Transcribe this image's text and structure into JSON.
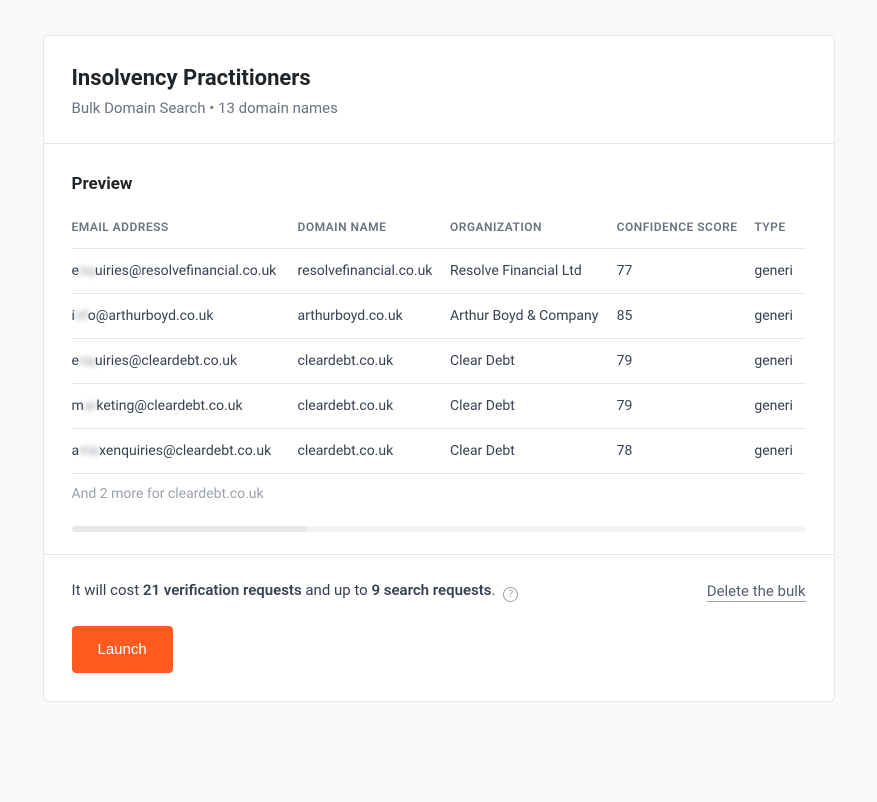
{
  "header": {
    "title": "Insolvency Practitioners",
    "subtitle": "Bulk Domain Search • 13 domain names"
  },
  "preview": {
    "title": "Preview",
    "columns": {
      "email": "EMAIL ADDRESS",
      "domain": "DOMAIN NAME",
      "org": "ORGANIZATION",
      "score": "CONFIDENCE SCORE",
      "type": "TYPE"
    },
    "rows": [
      {
        "prefix": "e",
        "obscured": "nq",
        "rest": "uiries@resolvefinancial.co.uk",
        "domain": "resolvefinancial.co.uk",
        "org": "Resolve Financial Ltd",
        "score": "77",
        "type": "generi"
      },
      {
        "prefix": "i",
        "obscured": "nf",
        "rest": "o@arthurboyd.co.uk",
        "domain": "arthurboyd.co.uk",
        "org": "Arthur Boyd & Company",
        "score": "85",
        "type": "generi"
      },
      {
        "prefix": "e",
        "obscured": "nq",
        "rest": "uiries@cleardebt.co.uk",
        "domain": "cleardebt.co.uk",
        "org": "Clear Debt",
        "score": "79",
        "type": "generi"
      },
      {
        "prefix": "m",
        "obscured": "ar",
        "rest": "keting@cleardebt.co.uk",
        "domain": "cleardebt.co.uk",
        "org": "Clear Debt",
        "score": "79",
        "type": "generi"
      },
      {
        "prefix": "a",
        "obscured": "me",
        "rest": "xenquiries@cleardebt.co.uk",
        "domain": "cleardebt.co.uk",
        "org": "Clear Debt",
        "score": "78",
        "type": "generi"
      }
    ],
    "more_note": "And 2 more for cleardebt.co.uk"
  },
  "footer": {
    "cost_prefix": "It will cost ",
    "verification": "21 verification requests",
    "cost_mid": " and up to ",
    "search": "9 search requests",
    "cost_suffix": ".",
    "delete_link": "Delete the bulk",
    "launch": "Launch"
  }
}
